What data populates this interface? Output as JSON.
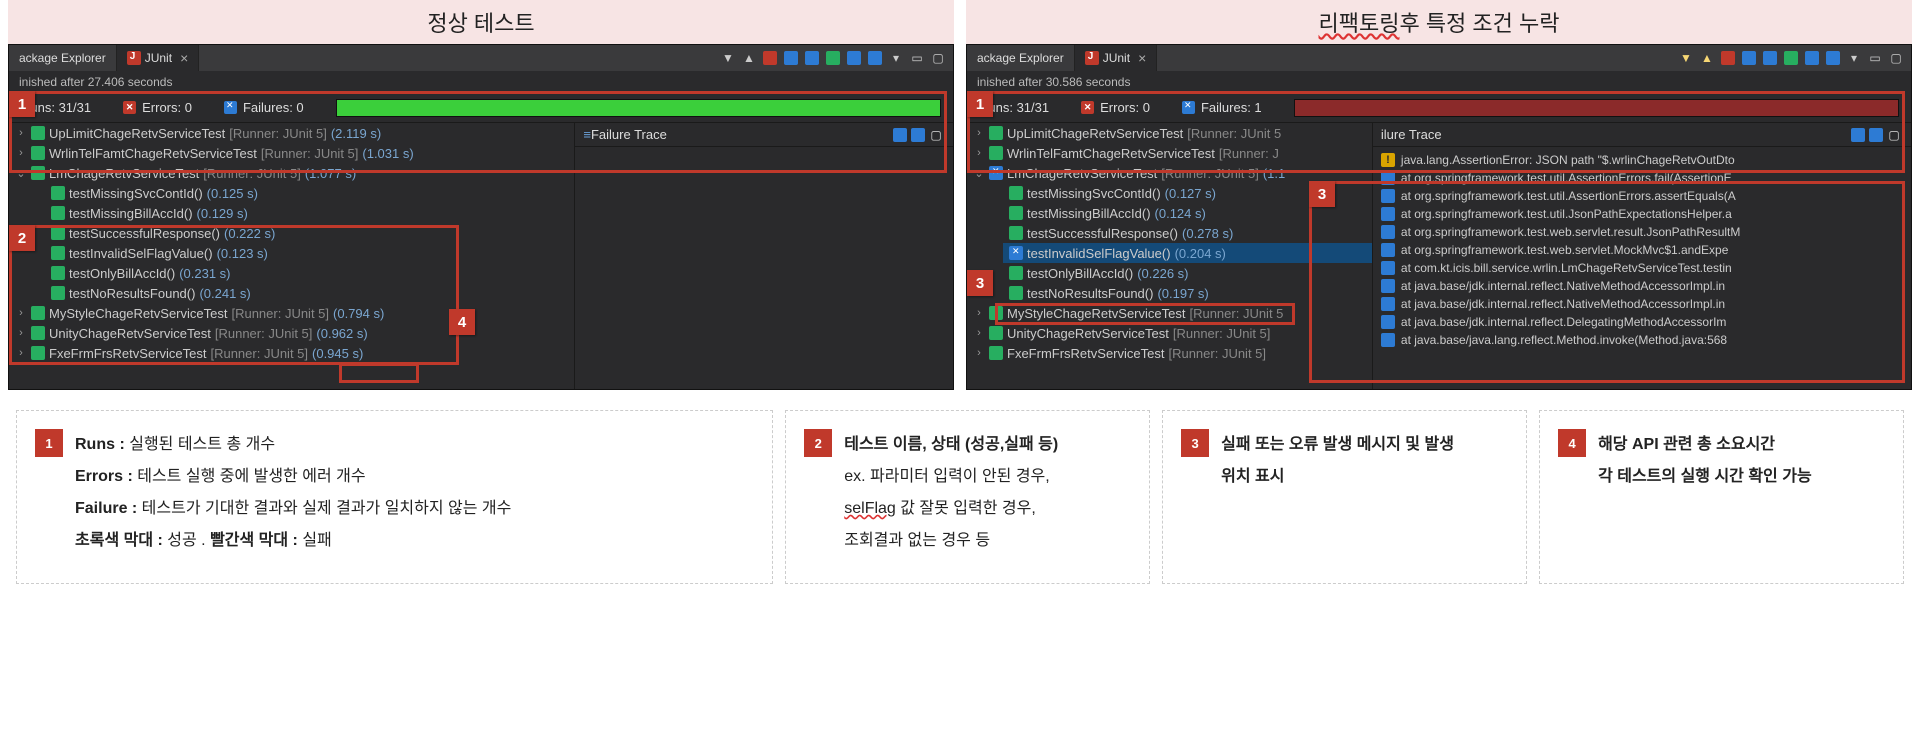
{
  "titles": {
    "left": "정상 테스트",
    "right_prefix": "리팩토링",
    "right_suffix": " 후 특정 조건 누락"
  },
  "tabs": {
    "pkg_explorer": "ackage Explorer",
    "junit": "JUnit"
  },
  "left": {
    "finished": "inished after 27.406 seconds",
    "runs": "Runs:  31/31",
    "errors": "Errors:  0",
    "failures": "Failures:  0",
    "trace_title": "Failure Trace",
    "tests": [
      {
        "name": "UpLimitChageRetvServiceTest",
        "runner": " [Runner: JUnit 5]",
        "time": " (2.119 s)",
        "icon": "pass",
        "top": true
      },
      {
        "name": "WrlinTelFamtChageRetvServiceTest",
        "runner": " [Runner: JUnit 5]",
        "time": " (1.031 s)",
        "icon": "pass",
        "top": true
      },
      {
        "name": "LmChageRetvServiceTest",
        "runner": " [Runner: JUnit 5]",
        "time": " (1.077 s)",
        "icon": "pass",
        "top": true,
        "open": true
      },
      {
        "name": "testMissingSvcContId()",
        "time": " (0.125 s)",
        "icon": "pass"
      },
      {
        "name": "testMissingBillAccId()",
        "time": " (0.129 s)",
        "icon": "pass"
      },
      {
        "name": "testSuccessfulResponse()",
        "time": " (0.222 s)",
        "icon": "pass"
      },
      {
        "name": "testInvalidSelFlagValue()",
        "time": " (0.123 s)",
        "icon": "pass"
      },
      {
        "name": "testOnlyBillAccId()",
        "time": " (0.231 s)",
        "icon": "pass"
      },
      {
        "name": "testNoResultsFound()",
        "time": " (0.241 s)",
        "icon": "pass"
      },
      {
        "name": "MyStyleChageRetvServiceTest",
        "runner": " [Runner: JUnit 5]",
        "time": " (0.794 s)",
        "icon": "pass",
        "top": true
      },
      {
        "name": "UnityChageRetvServiceTest",
        "runner": " [Runner: JUnit 5]",
        "time": " (0.962 s)",
        "icon": "pass",
        "top": true
      },
      {
        "name": "FxeFrmFrsRetvServiceTest",
        "runner": " [Runner: JUnit 5]",
        "time": " (0.945 s)",
        "icon": "pass",
        "top": true
      }
    ]
  },
  "right": {
    "finished": "inished after 30.586 seconds",
    "runs": "Runs:  31/31",
    "errors": "Errors:  0",
    "failures": "Failures:  1",
    "trace_title": "ilure Trace",
    "tests": [
      {
        "name": "UpLimitChageRetvServiceTest",
        "runner": " [Runner: JUnit 5",
        "time": "",
        "icon": "pass",
        "top": true
      },
      {
        "name": "WrlinTelFamtChageRetvServiceTest",
        "runner": " [Runner: J",
        "time": "",
        "icon": "pass",
        "top": true
      },
      {
        "name": "LmChageRetvServiceTest",
        "runner": " [Runner: JUnit 5]",
        "time": " (1.1",
        "icon": "failx",
        "top": true,
        "open": true
      },
      {
        "name": "testMissingSvcContId()",
        "time": " (0.127 s)",
        "icon": "pass"
      },
      {
        "name": "testMissingBillAccId()",
        "time": " (0.124 s)",
        "icon": "pass"
      },
      {
        "name": "testSuccessfulResponse()",
        "time": " (0.278 s)",
        "icon": "pass"
      },
      {
        "name": "testInvalidSelFlagValue()",
        "time": " (0.204 s)",
        "icon": "failx",
        "sel": true
      },
      {
        "name": "testOnlyBillAccId()",
        "time": " (0.226 s)",
        "icon": "pass"
      },
      {
        "name": "testNoResultsFound()",
        "time": " (0.197 s)",
        "icon": "pass"
      },
      {
        "name": "MyStyleChageRetvServiceTest",
        "runner": " [Runner: JUnit 5",
        "time": "",
        "icon": "pass",
        "top": true
      },
      {
        "name": "UnityChageRetvServiceTest",
        "runner": " [Runner: JUnit 5]",
        "time": "",
        "icon": "pass",
        "top": true
      },
      {
        "name": "FxeFrmFrsRetvServiceTest",
        "runner": " [Runner: JUnit 5]",
        "time": "",
        "icon": "pass",
        "top": true
      }
    ],
    "trace": [
      {
        "t": "bang",
        "txt": "java.lang.AssertionError: JSON path \"$.wrlinChageRetvOutDto"
      },
      {
        "t": "stk",
        "txt": "at org.springframework.test.util.AssertionErrors.fail(AssertionE"
      },
      {
        "t": "stk",
        "txt": "at org.springframework.test.util.AssertionErrors.assertEquals(A"
      },
      {
        "t": "stk",
        "txt": "at org.springframework.test.util.JsonPathExpectationsHelper.a"
      },
      {
        "t": "stk",
        "txt": "at org.springframework.test.web.servlet.result.JsonPathResultM"
      },
      {
        "t": "stk",
        "txt": "at org.springframework.test.web.servlet.MockMvc$1.andExpe"
      },
      {
        "t": "stk",
        "txt": "at com.kt.icis.bill.service.wrlin.LmChageRetvServiceTest.testin"
      },
      {
        "t": "stk",
        "txt": "at java.base/jdk.internal.reflect.NativeMethodAccessorImpl.in"
      },
      {
        "t": "stk",
        "txt": "at java.base/jdk.internal.reflect.NativeMethodAccessorImpl.in"
      },
      {
        "t": "stk",
        "txt": "at java.base/jdk.internal.reflect.DelegatingMethodAccessorIm"
      },
      {
        "t": "stk",
        "txt": "at java.base/java.lang.reflect.Method.invoke(Method.java:568"
      }
    ]
  },
  "legend": {
    "b1": {
      "l1": "Runs : 실행된 테스트 총 개수",
      "l2": "Errors :  테스트 실행 중에 발생한 에러 개수",
      "l3": "Failure : 테스트가 기대한 결과와 실제 결과가 일치하지 않는 개수",
      "l4": "초록색 막대 : 성공 . 빨간색 막대 : 실패"
    },
    "b2": {
      "l1": "테스트 이름, 상태 (성공,실패 등)",
      "l2": "ex. 파라미터 입력이 안된 경우,",
      "l3_u": "selFlag",
      "l3_rest": " 값 잘못 입력한 경우,",
      "l4": "조회결과 없는 경우 등"
    },
    "b3": {
      "l1": "실패 또는 오류 발생 메시지 및 발생",
      "l2": "위치 표시"
    },
    "b4": {
      "l1": "해당 API 관련 총 소요시간",
      "l2": "각 테스트의 실행 시간 확인 가능"
    }
  }
}
